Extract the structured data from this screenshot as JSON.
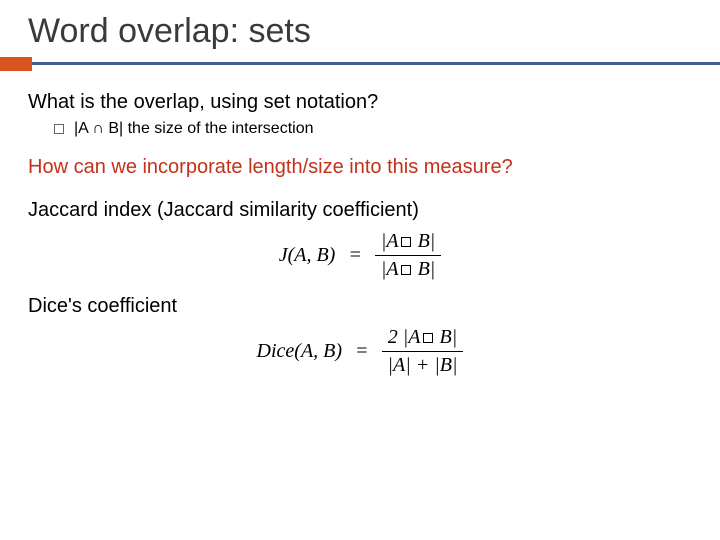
{
  "title": "Word overlap: sets",
  "q1": "What is the overlap, using set notation?",
  "bullet1": "|A ∩ B| the size of the intersection",
  "q2": "How can we incorporate length/size into this measure?",
  "q3": "Jaccard index (Jaccard similarity coefficient)",
  "q4": "Dice's coefficient",
  "jaccard": {
    "lhs": "J(A, B)",
    "eq": "=",
    "num_pre": "|A",
    "num_post": " B|",
    "den_pre": "|A",
    "den_post": " B|"
  },
  "dice": {
    "lhs": "Dice(A, B)",
    "eq": "=",
    "num_pre": "2 |A",
    "num_post": " B|",
    "den": "|A| + |B|"
  }
}
